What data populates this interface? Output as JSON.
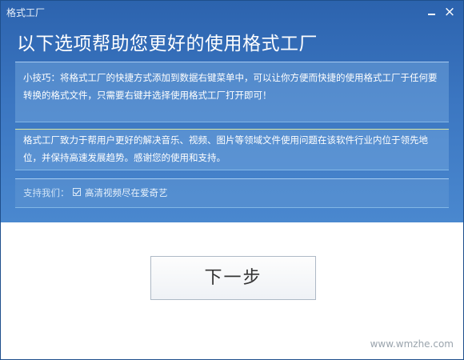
{
  "window": {
    "title": "格式工厂",
    "minimize_glyph": "—",
    "close_glyph": "×"
  },
  "heading": "以下选项帮助您更好的使用格式工厂",
  "tip_panel": {
    "text": "小技巧：将格式工厂的快捷方式添加到数据右键菜单中，可以让你方便而快捷的使用格式工厂于任何要转换的格式文件，只需要右键并选择使用格式工厂打开即可！"
  },
  "intro_panel": {
    "text": "格式工厂致力于帮用户更好的解决音乐、视频、图片等领域文件使用问题在该软件行业内位于领先地位，并保持高速发展趋势。感谢您的使用和支持。"
  },
  "support": {
    "label": "支持我们：",
    "checkbox_label": "高清视频尽在爱奇艺",
    "checked": true
  },
  "next_button_label": "下一步",
  "watermark": "www.wmzhe.com",
  "colors": {
    "header_blue": "#2c63ae",
    "panel_text": "#ffffff"
  }
}
